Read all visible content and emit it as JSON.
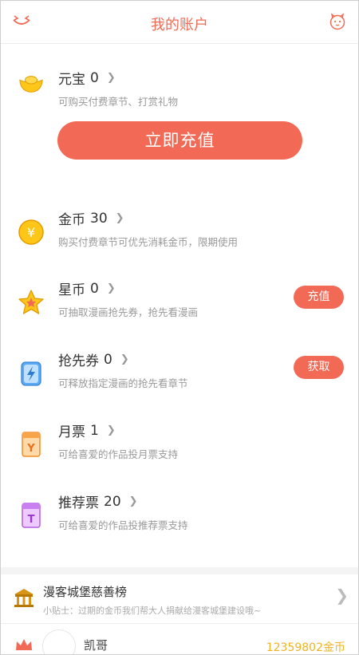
{
  "header": {
    "title": "我的账户",
    "left_icon": "logo-mascot-icon",
    "right_icon": "mascot-avatar-icon"
  },
  "yuanbao": {
    "label": "元宝",
    "value": "0",
    "desc": "可购买付费章节、打赏礼物",
    "button": "立即充值"
  },
  "rows": [
    {
      "label": "金币",
      "value": "30",
      "desc": "购买付费章节可优先消耗金币，限期使用"
    },
    {
      "label": "星币",
      "value": "0",
      "desc": "可抽取漫画抢先券，抢先看漫画",
      "button": "充值"
    },
    {
      "label": "抢先券",
      "value": "0",
      "desc": "可释放指定漫画的抢先看章节",
      "button": "获取"
    },
    {
      "label": "月票",
      "value": "1",
      "desc": "可给喜爱的作品投月票支持"
    },
    {
      "label": "推荐票",
      "value": "20",
      "desc": "可给喜爱的作品投推荐票支持"
    }
  ],
  "charity": {
    "title": "漫客城堡慈善榜",
    "tip": "小贴士：过期的金币我们帮大人捐献给漫客城堡建设哦~"
  },
  "leaderboard": {
    "user": "凯哥",
    "coins": "12359802金币"
  },
  "colors": {
    "accent": "#f26a55",
    "gold": "#f0b324",
    "text": "#333333",
    "muted": "#999999"
  }
}
